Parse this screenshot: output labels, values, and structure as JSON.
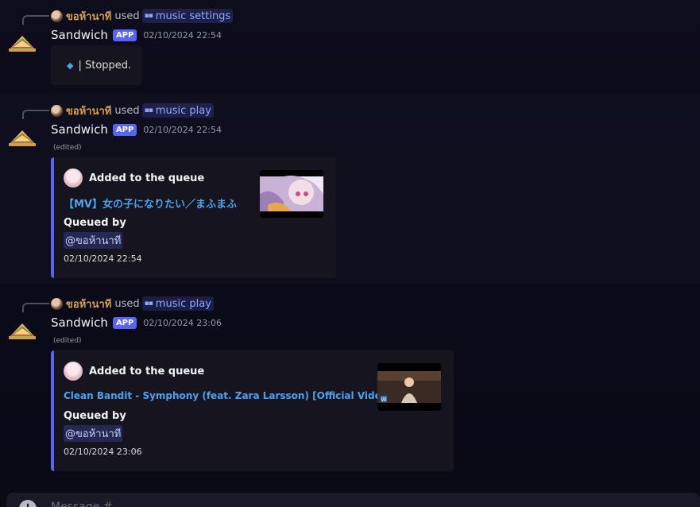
{
  "messages": [
    {
      "reply": {
        "user": "ขอห้านาที",
        "used": "used",
        "command": "music settings"
      },
      "author": "Sandwich",
      "badge": "APP",
      "timestamp": "02/10/2024 22:54",
      "embed_text": "| Stopped."
    },
    {
      "reply": {
        "user": "ขอห้านาที",
        "used": "used",
        "command": "music play"
      },
      "author": "Sandwich",
      "badge": "APP",
      "timestamp": "02/10/2024 22:54",
      "edited": "(edited)",
      "embed": {
        "author": "Added to the queue",
        "title": "【MV】女の子になりたい／まふまふ",
        "field_name": "Queued by",
        "field_value": "@ขอห้านาที",
        "footer": "02/10/2024 22:54"
      }
    },
    {
      "reply": {
        "user": "ขอห้านาที",
        "used": "used",
        "command": "music play"
      },
      "author": "Sandwich",
      "badge": "APP",
      "timestamp": "02/10/2024 23:06",
      "edited": "(edited)",
      "embed": {
        "author": "Added to the queue",
        "title": "Clean Bandit - Symphony (feat. Zara Larsson) [Official Video]",
        "field_name": "Queued by",
        "field_value": "@ขอห้านาที",
        "footer": "02/10/2024 23:06"
      }
    }
  ],
  "composer": {
    "placeholder": "Message #"
  },
  "colors": {
    "accent": "#5865f2",
    "link": "#4aa3f0",
    "username": "#d6a04a"
  }
}
